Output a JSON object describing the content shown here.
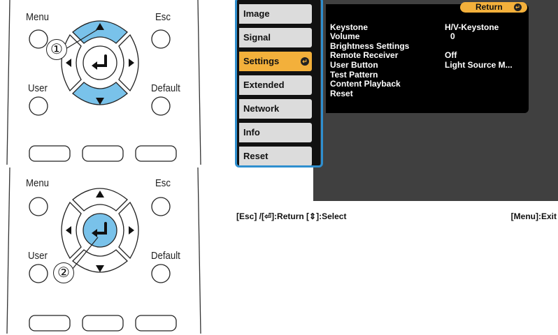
{
  "remote_top": {
    "labels": {
      "menu": "Menu",
      "esc": "Esc",
      "user": "User",
      "default": "Default"
    },
    "step": "①"
  },
  "remote_bottom": {
    "labels": {
      "menu": "Menu",
      "esc": "Esc",
      "user": "User",
      "default": "Default"
    },
    "step": "②"
  },
  "colors": {
    "highlight": "#79c2ea",
    "accent_orange": "#f3b03b",
    "osd_frame": "#2f8fcf"
  },
  "osd": {
    "sidebar": [
      {
        "label": "Image"
      },
      {
        "label": "Signal"
      },
      {
        "label": "Settings",
        "active": true
      },
      {
        "label": "Extended"
      },
      {
        "label": "Network"
      },
      {
        "label": "Info"
      },
      {
        "label": "Reset"
      }
    ],
    "return_label": "Return",
    "rows": [
      {
        "label": "Keystone",
        "value": "H/V-Keystone"
      },
      {
        "label": "Volume",
        "value": "0"
      },
      {
        "label": "Brightness Settings",
        "value": ""
      },
      {
        "label": "Remote Receiver",
        "value": "Off"
      },
      {
        "label": "User Button",
        "value": "Light Source M..."
      },
      {
        "label": "Test Pattern",
        "value": ""
      },
      {
        "label": "Content Playback",
        "value": ""
      },
      {
        "label": "Reset",
        "value": ""
      }
    ]
  },
  "footer": {
    "left": "[Esc] /[⏎]:Return  [⇕]:Select",
    "right": "[Menu]:Exit"
  }
}
